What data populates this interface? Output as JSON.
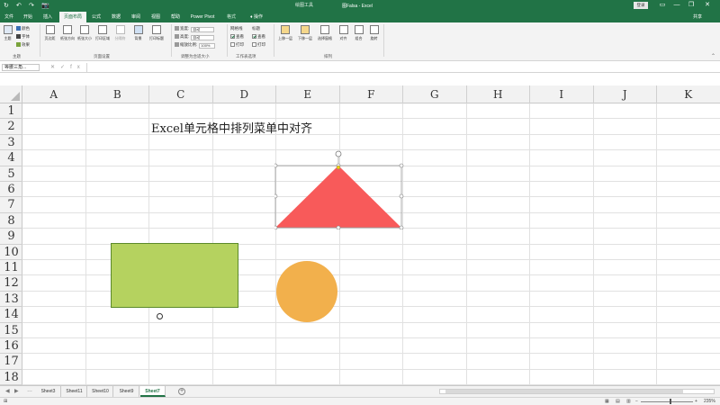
{
  "title_bar": {
    "quick_access": [
      "↻",
      "↶",
      "↷",
      "📷"
    ],
    "tools_label": "绘图工具",
    "doc_title": "图Falsa - Excel",
    "sign_in": "登录",
    "window_buttons": [
      "▭",
      "—",
      "❐",
      "✕"
    ]
  },
  "tabs": [
    {
      "label": "文件",
      "active": false
    },
    {
      "label": "开始",
      "active": false
    },
    {
      "label": "插入",
      "active": false
    },
    {
      "label": "页面布局",
      "active": true
    },
    {
      "label": "公式",
      "active": false
    },
    {
      "label": "数据",
      "active": false
    },
    {
      "label": "审阅",
      "active": false
    },
    {
      "label": "视图",
      "active": false
    },
    {
      "label": "帮助",
      "active": false
    },
    {
      "label": "Power Pivot",
      "active": false
    },
    {
      "label": "格式",
      "active": false,
      "context": true
    },
    {
      "label": "操作",
      "active": false
    }
  ],
  "share_label": "共享",
  "ribbon": {
    "themes": {
      "big": "主题",
      "colors": "颜色",
      "fonts": "字体",
      "effects": "效果",
      "group": "主题"
    },
    "page_setup": {
      "buttons": [
        "页边距",
        "纸张方向",
        "纸张大小",
        "打印区域",
        "分隔符",
        "背景",
        "打印标题"
      ],
      "group": "页面设置"
    },
    "scale": {
      "width_label": "宽度:",
      "width_value": "自动",
      "height_label": "高度:",
      "height_value": "自动",
      "scale_label": "缩放比例:",
      "scale_value": "100%",
      "group": "调整为合适大小"
    },
    "sheet_options": {
      "gridlines": "网格线",
      "headings": "标题",
      "view": "查看",
      "print": "打印",
      "group": "工作表选项"
    },
    "arrange": {
      "buttons": [
        "上移一层",
        "下移一层",
        "选择窗格",
        "对齐",
        "组合",
        "旋转"
      ],
      "group": "排列"
    }
  },
  "formula_bar": {
    "name_box": "等腰三角...",
    "icons": [
      "✕",
      "✓",
      "fx"
    ],
    "value": ""
  },
  "grid": {
    "columns": [
      "A",
      "B",
      "C",
      "D",
      "E",
      "F",
      "G",
      "H",
      "I",
      "J",
      "K"
    ],
    "rows": [
      "1",
      "2",
      "3",
      "4",
      "5",
      "6",
      "7",
      "8",
      "9",
      "10",
      "11",
      "12",
      "13",
      "14",
      "15",
      "16",
      "17",
      "18"
    ],
    "cell_c2": "Excel单元格中排列菜单中对齐"
  },
  "shapes": {
    "triangle_color": "#f85a5a",
    "rectangle_color": "#b5d25f",
    "circle_color": "#f2b04c"
  },
  "sheet_tabs": [
    {
      "label": "Sheet3",
      "active": false
    },
    {
      "label": "Sheet11",
      "active": false
    },
    {
      "label": "Sheet10",
      "active": false
    },
    {
      "label": "Sheet9",
      "active": false
    },
    {
      "label": "Sheet7",
      "active": true
    }
  ],
  "status": {
    "zoom": "235%",
    "mode_icon": "⊞"
  }
}
